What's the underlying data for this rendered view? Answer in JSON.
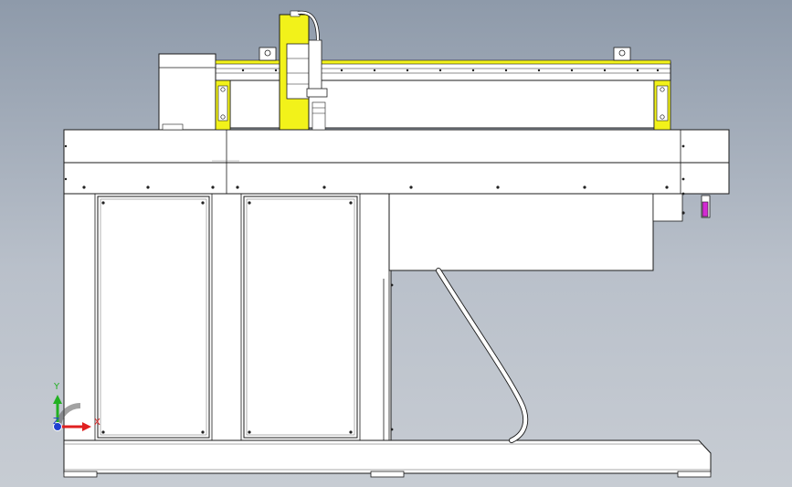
{
  "app": {
    "title": ""
  },
  "triad": {
    "y_label": "Y",
    "x_label": "X",
    "z_label": "Z"
  },
  "colors": {
    "background_top": "#8e9aaa",
    "background_bottom": "#c7ccd3",
    "part_fill": "#ffffff",
    "line": "#1b1b1b",
    "accent_yellow": "#f2f21a",
    "accent_magenta": "#d22bd2",
    "axis_y": "#22b022",
    "axis_x": "#e02020",
    "axis_z": "#2040d0"
  },
  "icons": {
    "triad": "coordinate-triad-icon"
  }
}
